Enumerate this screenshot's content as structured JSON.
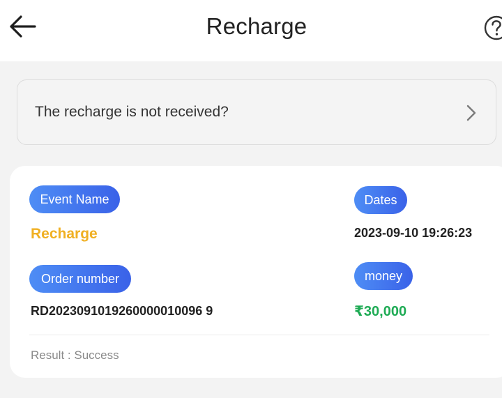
{
  "header": {
    "title": "Recharge",
    "back_icon": "arrow-left-icon",
    "help_icon": "question-circle-icon"
  },
  "notice": {
    "text": "The recharge is not received?",
    "chevron_icon": "chevron-right-icon"
  },
  "record": {
    "event_label": "Event Name",
    "event_value": "Recharge",
    "dates_label": "Dates",
    "dates_value": "2023-09-10 19:26:23",
    "order_label": "Order number",
    "order_value": "RD2023091019260000010096 9",
    "money_label": "money",
    "money_value": "₹30,000",
    "result_text": "Result : Success"
  },
  "colors": {
    "accent_blue": "#3a62e8",
    "event_yellow": "#f0b023",
    "money_green": "#1fab55"
  }
}
